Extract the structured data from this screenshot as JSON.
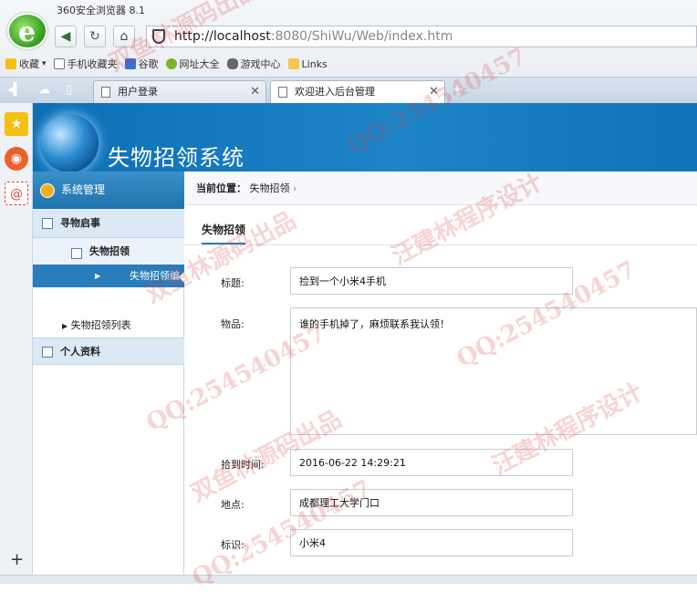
{
  "browser": {
    "title": "360安全浏览器 8.1",
    "address_host": "http://localhost",
    "address_rest": ":8080/ShiWu/Web/index.htm",
    "bookmarks": [
      "收藏",
      "手机收藏夹",
      "谷歌",
      "网址大全",
      "游戏中心",
      "Links"
    ],
    "tabs": [
      {
        "label": "用户登录",
        "active": false
      },
      {
        "label": "欢迎进入后台管理",
        "active": true
      }
    ],
    "new_tab": "+"
  },
  "app": {
    "title": "失物招领系统"
  },
  "sidebar": {
    "header": "系统管理",
    "section1": "寻物启事",
    "sub1": "失物招领",
    "active_item": "失物招领编",
    "list_item": "失物招领列表",
    "section2": "个人资料"
  },
  "breadcrumb": {
    "prefix": "当前位置：",
    "current": "失物招领",
    "sep": "›"
  },
  "content_tab": "失物招领",
  "form": {
    "title_label": "标题:",
    "title_value": "捡到一个小米4手机",
    "item_label": "物品:",
    "item_value": "谁的手机掉了，麻烦联系我认领！",
    "time_label": "拾到时间:",
    "time_value": "2016-06-22 14:29:21",
    "place_label": "地点:",
    "place_value": "成都理工大学门口",
    "tag_label": "标识:",
    "tag_value": "小米4"
  },
  "watermarks": [
    "双鱼林源码出品",
    "QQ:254540457",
    "汪建林程序设计"
  ],
  "colors": {
    "banner": "#1c84c7",
    "active": "#2a7dbb",
    "section_bg": "#dbe9f5"
  }
}
